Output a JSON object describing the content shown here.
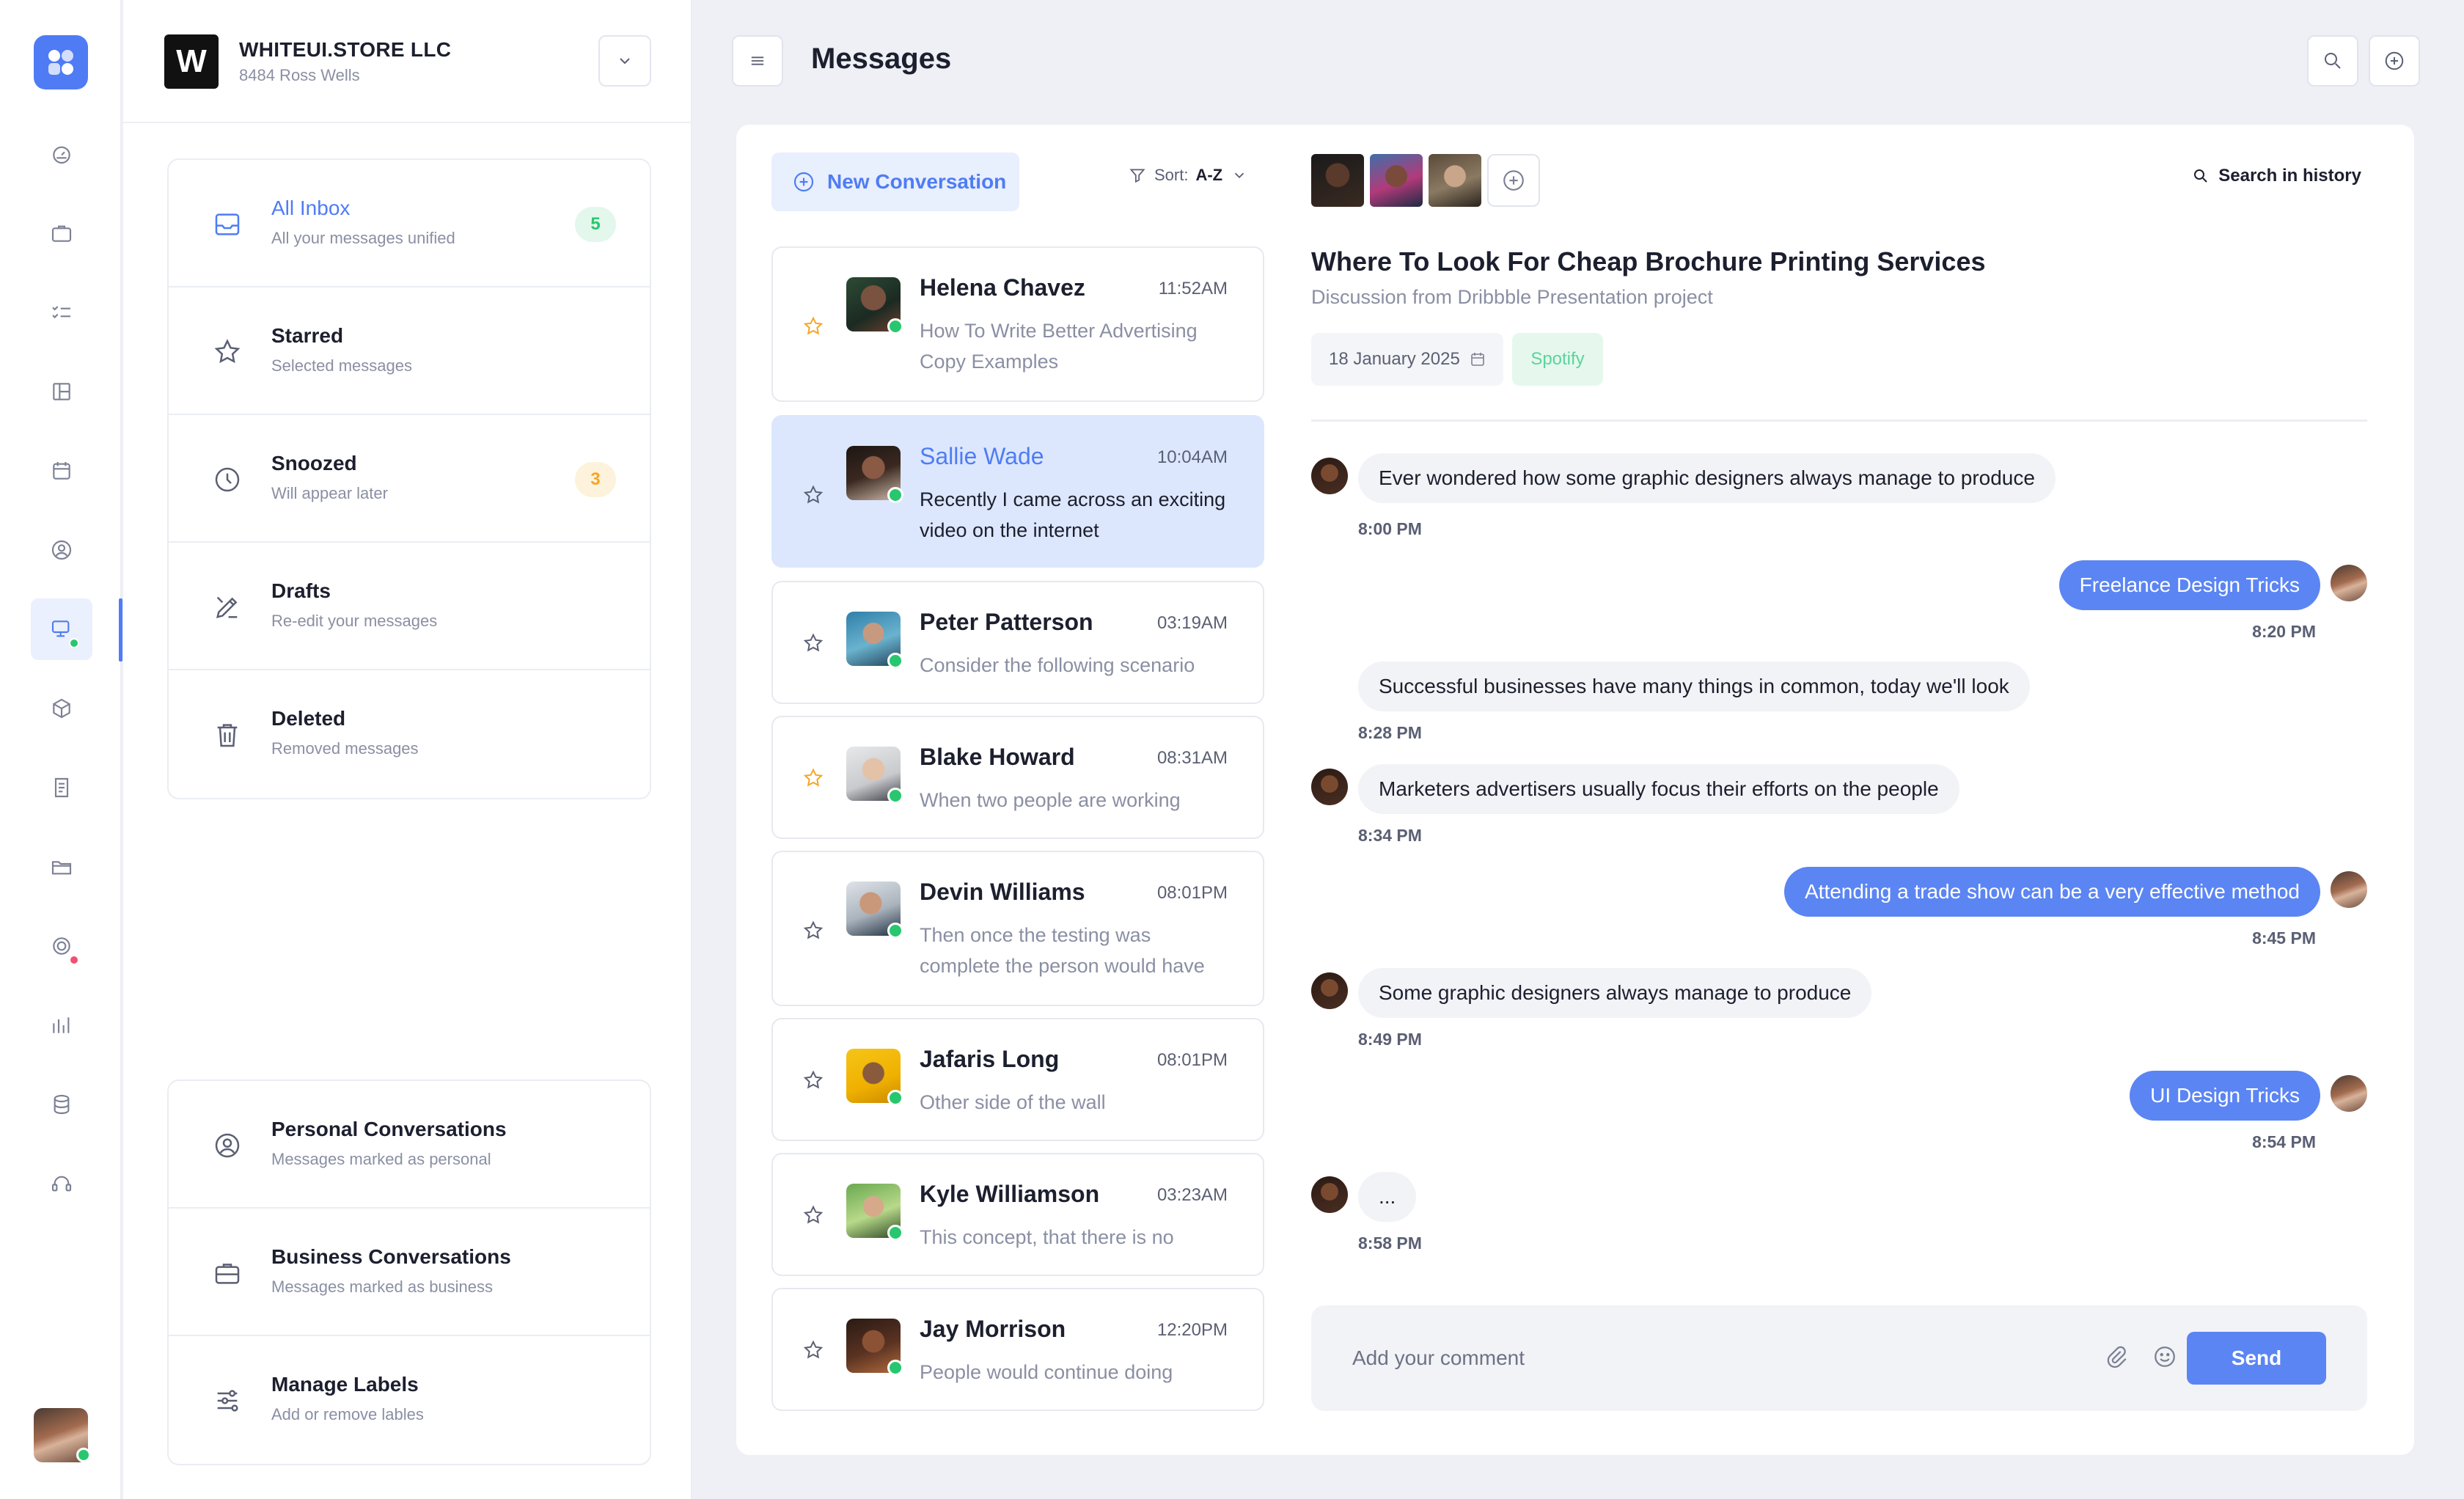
{
  "company": {
    "logo_letter": "W",
    "name": "WHITEUI.STORE LLC",
    "address": "8484 Ross Wells"
  },
  "rail": {
    "items": [
      {
        "icon": "dashboard-icon"
      },
      {
        "icon": "briefcase-icon"
      },
      {
        "icon": "task-list-icon"
      },
      {
        "icon": "layout-icon"
      },
      {
        "icon": "calendar-icon"
      },
      {
        "icon": "user-circle-icon"
      },
      {
        "icon": "messages-icon",
        "active": true
      },
      {
        "icon": "package-icon"
      },
      {
        "icon": "invoice-icon"
      },
      {
        "icon": "folder-icon"
      },
      {
        "icon": "target-icon"
      },
      {
        "icon": "analytics-icon"
      },
      {
        "icon": "database-icon"
      },
      {
        "icon": "support-icon"
      }
    ]
  },
  "folders": {
    "top": [
      {
        "title": "All Inbox",
        "subtitle": "All your messages unified",
        "badge": "5",
        "icon": "inbox-icon",
        "active": true
      },
      {
        "title": "Starred",
        "subtitle": "Selected messages",
        "badge": "",
        "icon": "star-icon"
      },
      {
        "title": "Snoozed",
        "subtitle": "Will appear later",
        "badge": "3",
        "icon": "clock-icon"
      },
      {
        "title": "Drafts",
        "subtitle": "Re-edit your messages",
        "badge": "",
        "icon": "edit-icon"
      },
      {
        "title": "Deleted",
        "subtitle": "Removed messages",
        "badge": "",
        "icon": "trash-icon"
      }
    ],
    "bottom": [
      {
        "title": "Personal Conversations",
        "subtitle": "Messages marked as personal",
        "icon": "user-circle-icon"
      },
      {
        "title": "Business Conversations",
        "subtitle": "Messages marked as business",
        "icon": "briefcase-icon"
      },
      {
        "title": "Manage Labels",
        "subtitle": "Add or remove lables",
        "icon": "sliders-icon"
      }
    ]
  },
  "header": {
    "title": "Messages"
  },
  "conversation_list": {
    "new_label": "New Conversation",
    "sort_label": "Sort:",
    "sort_value": "A-Z",
    "items": [
      {
        "name": "Helena Chavez",
        "time": "11:52AM",
        "preview": "How To Write Better Advertising Copy Examples",
        "starred": true
      },
      {
        "name": "Sallie Wade",
        "time": "10:04AM",
        "preview": "Recently I came across an exciting video on the internet",
        "starred": false,
        "active": true
      },
      {
        "name": "Peter Patterson",
        "time": "03:19AM",
        "preview": "Consider the following scenario",
        "starred": false
      },
      {
        "name": "Blake Howard",
        "time": "08:31AM",
        "preview": "When two people are working",
        "starred": true
      },
      {
        "name": "Devin Williams",
        "time": "08:01PM",
        "preview": "Then once the testing was complete the person would have",
        "starred": false
      },
      {
        "name": "Jafaris Long",
        "time": "08:01PM",
        "preview": "Other side of the wall",
        "starred": false
      },
      {
        "name": "Kyle Williamson",
        "time": "03:23AM",
        "preview": "This concept, that there is no",
        "starred": false
      },
      {
        "name": "Jay Morrison",
        "time": "12:20PM",
        "preview": "People would continue doing",
        "starred": false
      }
    ]
  },
  "chat": {
    "search_label": "Search in history",
    "title": "Where To Look For Cheap Brochure Printing Services",
    "subtitle": "Discussion from Dribbble Presentation project",
    "date": "18 January 2025",
    "tag": "Spotify",
    "messages": [
      {
        "dir": "in",
        "text": "Ever wondered how some graphic designers always manage to produce",
        "time": "8:00 PM"
      },
      {
        "dir": "out",
        "text": "Freelance Design Tricks",
        "time": "8:20 PM"
      },
      {
        "dir": "in",
        "text": "Successful businesses have many things in common, today we'll look",
        "time": "8:28 PM",
        "no_avatar": true
      },
      {
        "dir": "in",
        "text": "Marketers advertisers usually focus their efforts on the people",
        "time": "8:34 PM"
      },
      {
        "dir": "out",
        "text": "Attending a trade show can be a very effective method",
        "time": "8:45 PM"
      },
      {
        "dir": "in",
        "text": "Some graphic designers always manage to produce",
        "time": "8:49 PM"
      },
      {
        "dir": "out",
        "text": "UI Design Tricks",
        "time": "8:54 PM"
      },
      {
        "dir": "in",
        "text": "...",
        "time": "8:58 PM"
      }
    ],
    "composer_placeholder": "Add your comment",
    "send_label": "Send"
  },
  "colors": {
    "accent": "#4f7cf4",
    "success": "#28c76f",
    "warning": "#f6a623",
    "danger": "#f0506e"
  }
}
